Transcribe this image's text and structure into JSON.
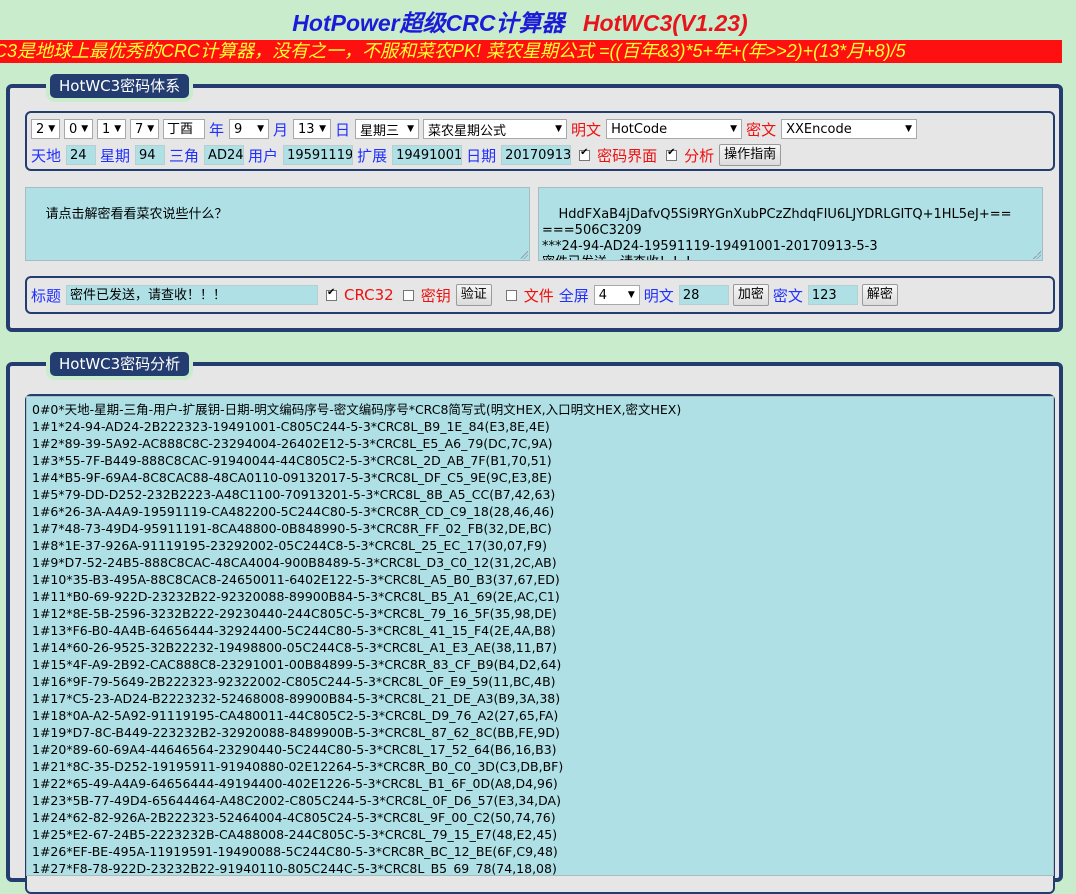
{
  "title": {
    "name": "HotPower超级CRC计算器",
    "version": "HotWC3(V1.23)"
  },
  "marquee": "C3是地球上最优秀的CRC计算器，没有之一，不服和菜农PK!   菜农星期公式 =((百年&3)*5+年+(年>>2)+(13*月+8)/5",
  "panel1": {
    "legend": "HotWC3密码体系",
    "date_selects": [
      "2",
      "0",
      "1",
      "7"
    ],
    "ganzhi": "丁酉",
    "year_label": "年",
    "month_select": "9",
    "month_label": "月",
    "day_select": "13",
    "day_label": "日",
    "weekday_select": "星期三",
    "formula_select": "菜农星期公式",
    "plain_label": "明文",
    "plain_select": "HotCode",
    "cipher_label": "密文",
    "cipher_select": "XXEncode",
    "tiandi_label": "天地",
    "tiandi_value": "24",
    "xingqi_label": "星期",
    "xingqi_value": "94",
    "sanjiao_label": "三角",
    "sanjiao_value": "AD24",
    "user_label": "用户",
    "user_value": "19591119",
    "ext_label": "扩展",
    "ext_value": "19491001",
    "date_label": "日期",
    "date_value": "20170913",
    "cipher_ui_label": "密码界面",
    "analysis_label": "分析",
    "guide_button": "操作指南",
    "left_text": "请点击解密看看菜农说些什么？",
    "right_text": "HddFXaB4jDafvQ5Si9RYGnXubPCzZhdqFIU6LJYDRLGITQ+1HL5eJ+==\n===506C3209\n***24-94-AD24-19591119-19491001-20170913-5-3\n密件已发送，请查收！！！",
    "subject_label": "标题",
    "subject_value": "密件已发送，请查收！！！",
    "crc32_label": "CRC32",
    "key_label": "密钥",
    "verify_button": "验证",
    "file_label": "文件",
    "fullscreen_label": "全屏",
    "fullscreen_select": "4",
    "plain_len_label": "明文",
    "plain_len_value": "28",
    "encrypt_button": "加密",
    "cipher_len_label": "密文",
    "cipher_len_value": "123",
    "decrypt_button": "解密"
  },
  "panel2": {
    "legend": "HotWC3密码分析",
    "lines": [
      "0#0*天地-星期-三角-用户-扩展钥-日期-明文编码序号-密文编码序号*CRC8简写式(明文HEX,入口明文HEX,密文HEX)",
      "1#1*24-94-AD24-2B222323-19491001-C805C244-5-3*CRC8L_B9_1E_84(E3,8E,4E)",
      "1#2*89-39-5A92-AC888C8C-23294004-26402E12-5-3*CRC8L_E5_A6_79(DC,7C,9A)",
      "1#3*55-7F-B449-888C8CAC-91940044-44C805C2-5-3*CRC8L_2D_AB_7F(B1,70,51)",
      "1#4*B5-9F-69A4-8C8CAC88-48CA0110-09132017-5-3*CRC8L_DF_C5_9E(9C,E3,8E)",
      "1#5*79-DD-D252-232B2223-A48C1100-70913201-5-3*CRC8L_8B_A5_CC(B7,42,63)",
      "1#6*26-3A-A4A9-19591119-CA482200-5C244C80-5-3*CRC8R_CD_C9_18(28,46,46)",
      "1#7*48-73-49D4-95911191-8CA48800-0B848990-5-3*CRC8R_FF_02_FB(32,DE,BC)",
      "1#8*1E-37-926A-91119195-23292002-05C244C8-5-3*CRC8L_25_EC_17(30,07,F9)",
      "1#9*D7-52-24B5-888C8CAC-48CA4004-900B8489-5-3*CRC8L_D3_C0_12(31,2C,AB)",
      "1#10*35-B3-495A-88C8CAC8-24650011-6402E122-5-3*CRC8L_A5_B0_B3(37,67,ED)",
      "1#11*B0-69-922D-23232B22-92320088-89900B84-5-3*CRC8L_B5_A1_69(2E,AC,C1)",
      "1#12*8E-5B-2596-3232B222-29230440-244C805C-5-3*CRC8L_79_16_5F(35,98,DE)",
      "1#13*F6-B0-4A4B-64656444-32924400-5C244C80-5-3*CRC8L_41_15_F4(2E,4A,B8)",
      "1#14*60-26-9525-32B22232-19498800-05C244C8-5-3*CRC8L_A1_E3_AE(38,11,B7)",
      "1#15*4F-A9-2B92-CAC888C8-23291001-00B84899-5-3*CRC8R_83_CF_B9(B4,D2,64)",
      "1#16*9F-79-5649-2B222323-92322002-C805C244-5-3*CRC8L_0F_E9_59(11,BC,4B)",
      "1#17*C5-23-AD24-B2223232-52468008-89900B84-5-3*CRC8L_21_DE_A3(B9,3A,38)",
      "1#18*0A-A2-5A92-91119195-CA480011-44C805C2-5-3*CRC8L_D9_76_A2(27,65,FA)",
      "1#19*D7-8C-B449-223232B2-32920088-8489900B-5-3*CRC8L_87_62_8C(BB,FE,9D)",
      "1#20*89-60-69A4-44646564-23290440-5C244C80-5-3*CRC8L_17_52_64(B6,16,B3)",
      "1#21*8C-35-D252-19195911-91940880-02E12264-5-3*CRC8R_B0_C0_3D(C3,DB,BF)",
      "1#22*65-49-A4A9-64656444-49194400-402E1226-5-3*CRC8L_B1_6F_0D(A8,D4,96)",
      "1#23*5B-77-49D4-65644464-A48C2002-C805C244-5-3*CRC8L_0F_D6_57(E3,34,DA)",
      "1#24*62-82-926A-2B222323-52464004-4C805C24-5-3*CRC8L_9F_00_C2(50,74,76)",
      "1#25*E2-67-24B5-2223232B-CA488008-244C805C-5-3*CRC8L_79_15_E7(48,E2,45)",
      "1#26*EF-BE-495A-11919591-19490088-5C244C80-5-3*CRC8R_BC_12_BE(6F,C9,48)",
      "1#27*F8-78-922D-23232B22-91940110-805C244C-5-3*CRC8L_B5_69_78(74,18,08)"
    ]
  }
}
